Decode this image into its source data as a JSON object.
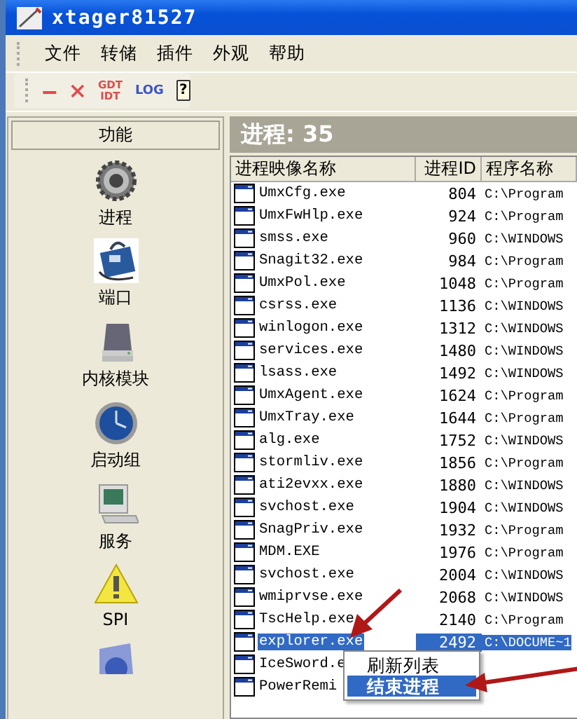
{
  "window": {
    "title": "xtager81527"
  },
  "menu": [
    "文件",
    "转储",
    "插件",
    "外观",
    "帮助"
  ],
  "toolbar": [
    {
      "kind": "minus"
    },
    {
      "kind": "delete"
    },
    {
      "kind": "label",
      "label": "GDT IDT"
    },
    {
      "kind": "label",
      "label": "LOG"
    },
    {
      "kind": "help",
      "label": "?"
    }
  ],
  "sidebar": {
    "title": "功能",
    "items": [
      {
        "kind": "item",
        "label": "进程"
      },
      {
        "kind": "item",
        "label": "端口"
      },
      {
        "kind": "item",
        "label": "内核模块"
      },
      {
        "kind": "item",
        "label": "启动组"
      },
      {
        "kind": "item",
        "label": "服务"
      },
      {
        "kind": "item",
        "label": "SPI"
      },
      {
        "kind": "icon"
      }
    ]
  },
  "panel": {
    "title": "进程: 35"
  },
  "table": {
    "columns": [
      "进程映像名称",
      "进程ID",
      "程序名称"
    ],
    "rows": [
      {
        "name": "UmxCfg.exe",
        "pid": "804",
        "path": "C:\\Program",
        "selected": false
      },
      {
        "name": "UmxFwHlp.exe",
        "pid": "924",
        "path": "C:\\Program",
        "selected": false
      },
      {
        "name": "smss.exe",
        "pid": "960",
        "path": "C:\\WINDOWS",
        "selected": false
      },
      {
        "name": "Snagit32.exe",
        "pid": "984",
        "path": "C:\\Program",
        "selected": false
      },
      {
        "name": "UmxPol.exe",
        "pid": "1048",
        "path": "C:\\Program",
        "selected": false
      },
      {
        "name": "csrss.exe",
        "pid": "1136",
        "path": "C:\\WINDOWS",
        "selected": false
      },
      {
        "name": "winlogon.exe",
        "pid": "1312",
        "path": "C:\\WINDOWS",
        "selected": false
      },
      {
        "name": "services.exe",
        "pid": "1480",
        "path": "C:\\WINDOWS",
        "selected": false
      },
      {
        "name": "lsass.exe",
        "pid": "1492",
        "path": "C:\\WINDOWS",
        "selected": false
      },
      {
        "name": "UmxAgent.exe",
        "pid": "1624",
        "path": "C:\\Program",
        "selected": false
      },
      {
        "name": "UmxTray.exe",
        "pid": "1644",
        "path": "C:\\Program",
        "selected": false
      },
      {
        "name": "alg.exe",
        "pid": "1752",
        "path": "C:\\WINDOWS",
        "selected": false
      },
      {
        "name": "stormliv.exe",
        "pid": "1856",
        "path": "C:\\Program",
        "selected": false
      },
      {
        "name": "ati2evxx.exe",
        "pid": "1880",
        "path": "C:\\WINDOWS",
        "selected": false
      },
      {
        "name": "svchost.exe",
        "pid": "1904",
        "path": "C:\\WINDOWS",
        "selected": false
      },
      {
        "name": "SnagPriv.exe",
        "pid": "1932",
        "path": "C:\\Program",
        "selected": false
      },
      {
        "name": "MDM.EXE",
        "pid": "1976",
        "path": "C:\\Program",
        "selected": false
      },
      {
        "name": "svchost.exe",
        "pid": "2004",
        "path": "C:\\WINDOWS",
        "selected": false
      },
      {
        "name": "wmiprvse.exe",
        "pid": "2068",
        "path": "C:\\WINDOWS",
        "selected": false
      },
      {
        "name": "TscHelp.exe",
        "pid": "2140",
        "path": "C:\\Program",
        "selected": false
      },
      {
        "name": "explorer.exe",
        "pid": "2492",
        "path": "C:\\DOCUME~1",
        "selected": true
      },
      {
        "name": "IceSword.e",
        "selected": false
      },
      {
        "name": "PowerRemi",
        "selected": false
      }
    ]
  },
  "context_menu": [
    {
      "label": "刷新列表",
      "selected": false
    },
    {
      "label": "结束进程",
      "selected": true
    }
  ]
}
